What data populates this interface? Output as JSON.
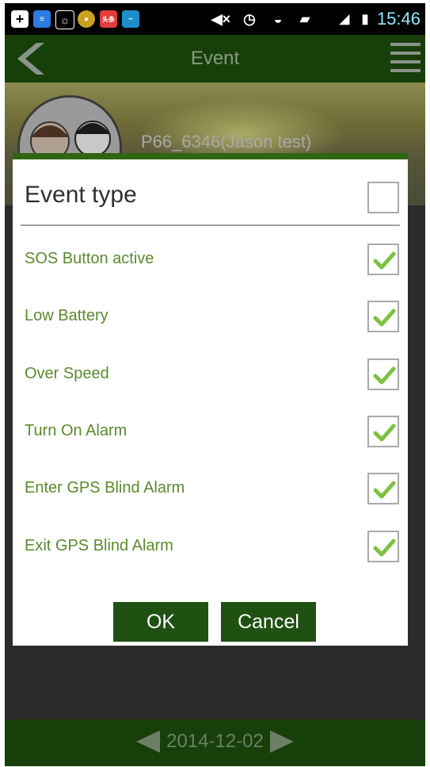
{
  "status_bar": {
    "time": "15:46",
    "icons": [
      "plus-icon",
      "news-icon",
      "weather-icon",
      "game-icon",
      "news-app-icon",
      "messenger-icon",
      "mute-icon",
      "alarm-icon",
      "wifi-icon",
      "signal-icon",
      "battery-icon"
    ],
    "accent": "#8fe8ff"
  },
  "header": {
    "title": "Event",
    "color": "#173f0a"
  },
  "banner": {
    "device_name": "P66_6346(Jason test)"
  },
  "dialog": {
    "title": "Event type",
    "accent": "#2e6613",
    "select_all_checked": false,
    "items": [
      {
        "label": "SOS Button active",
        "checked": true
      },
      {
        "label": "Low Battery",
        "checked": true
      },
      {
        "label": "Over Speed",
        "checked": true
      },
      {
        "label": "Turn On Alarm",
        "checked": true
      },
      {
        "label": "Enter GPS Blind Alarm",
        "checked": true
      },
      {
        "label": "Exit GPS Blind Alarm",
        "checked": true
      }
    ],
    "ok_label": "OK",
    "cancel_label": "Cancel",
    "check_color": "#7cc242"
  },
  "footer": {
    "date": "2014-12-02"
  }
}
